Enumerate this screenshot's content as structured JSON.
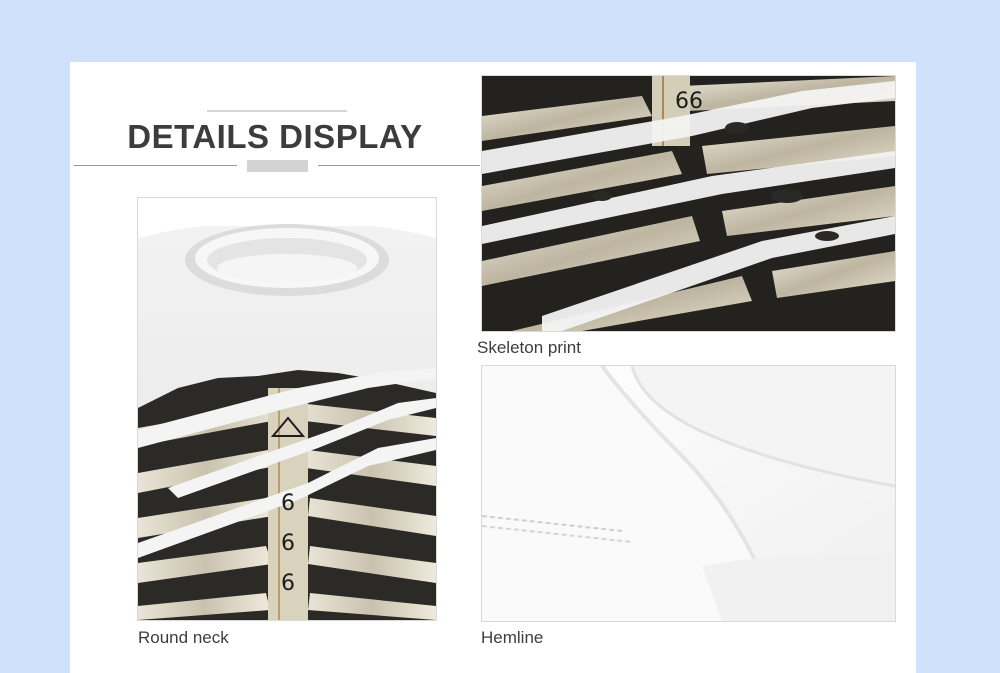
{
  "header": {
    "title": "DETAILS DISPLAY"
  },
  "photos": [
    {
      "caption": "Round neck",
      "image": "round-neck-tshirt-skeleton-print"
    },
    {
      "caption": "Skeleton print",
      "image": "skeleton-ribcage-print-closeup"
    },
    {
      "caption": "Hemline",
      "image": "white-fabric-hemline-stitching"
    }
  ],
  "print_text": "666",
  "colors": {
    "page_background": "#cfe1fb",
    "card_background": "#ffffff",
    "title_color": "#3c3c3c",
    "caption_color": "#3d3d3d"
  }
}
